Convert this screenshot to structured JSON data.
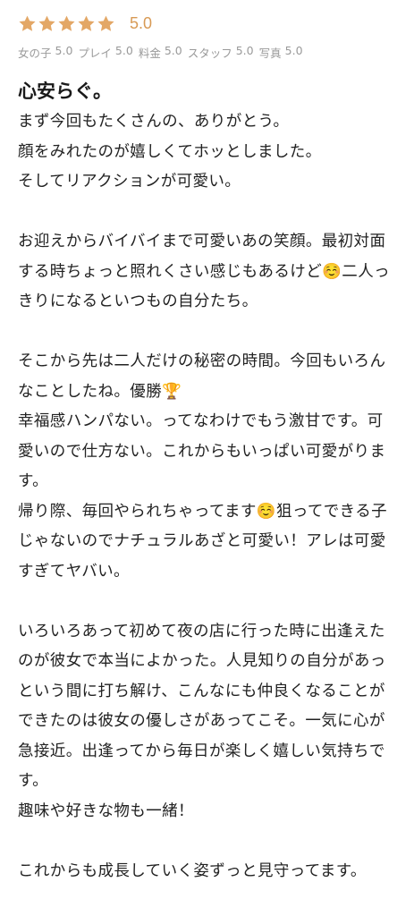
{
  "rating": {
    "star_count": 5,
    "score": "5.0",
    "star_color": "#e3a766",
    "star_icon": "star-icon"
  },
  "sub_scores": [
    {
      "label": "女の子",
      "value": "5.0"
    },
    {
      "label": "プレイ",
      "value": "5.0"
    },
    {
      "label": "料金",
      "value": "5.0"
    },
    {
      "label": "スタッフ",
      "value": "5.0"
    },
    {
      "label": "写真",
      "value": "5.0"
    }
  ],
  "review": {
    "title": "心安らぐ。",
    "body": "まず今回もたくさんの、ありがとう。\n顔をみれたのが嬉しくてホッとしました。\nそしてリアクションが可愛い。\n\nお迎えからバイバイまで可愛いあの笑顔。最初対面する時ちょっと照れくさい感じもあるけど☺️二人っきりになるといつもの自分たち。\n\nそこから先は二人だけの秘密の時間。今回もいろんなことしたね。優勝🏆\n幸福感ハンパない。ってなわけでもう激甘です。可愛いので仕方ない。これからもいっぱい可愛がります。\n帰り際、毎回やられちゃってます☺️狙ってできる子じゃないのでナチュラルあざと可愛い！アレは可愛すぎてヤバい。\n\nいろいろあって初めて夜の店に行った時に出逢えたのが彼女で本当によかった。人見知りの自分があっという間に打ち解け、こんなにも仲良くなることができたのは彼女の優しさがあってこそ。一気に心が急接近。出逢ってから毎日が楽しく嬉しい気持ちです。\n趣味や好きな物も一緒！\n\nこれからも成長していく姿ずっと見守ってます。"
  }
}
